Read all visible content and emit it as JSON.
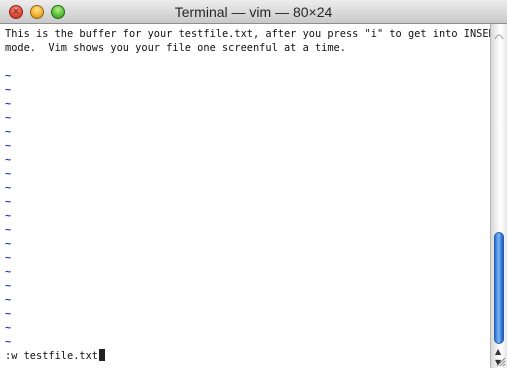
{
  "window": {
    "title": "Terminal — vim — 80×24",
    "controls": {
      "close_icon": "close-icon",
      "minimize_icon": "minimize-icon",
      "zoom_icon": "zoom-icon",
      "close_color": "#e24b3b",
      "minimize_color": "#f0b332",
      "zoom_color": "#5cc23a"
    }
  },
  "buffer": {
    "lines": [
      "This is the buffer for your testfile.txt, after you press \"i\" to get into INSERT",
      "mode.  Vim shows you your file one screenful at a time."
    ],
    "empty_line_marker": "~",
    "empty_line_color": "#2a3fb8"
  },
  "command_line": {
    "text": ":w testfile.txt"
  },
  "scrollbar": {
    "thumb_color": "#4b8fe6",
    "position_fraction": 0.65,
    "visible_fraction": 0.33
  }
}
